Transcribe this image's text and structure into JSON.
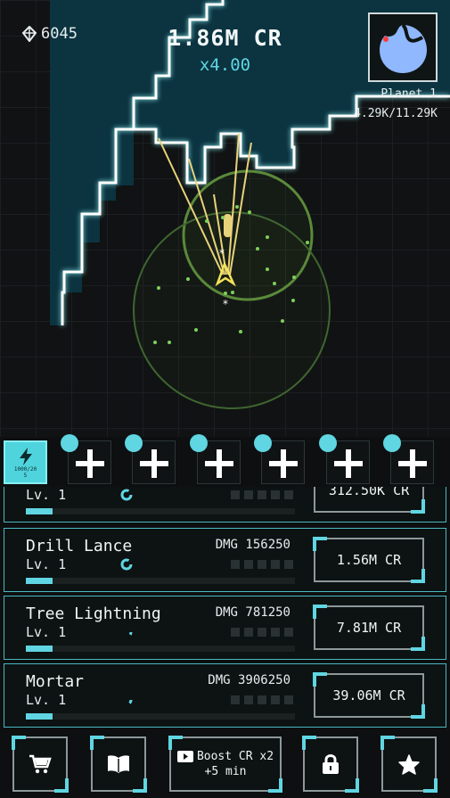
{
  "hud": {
    "gems": "6045",
    "credits": "1.86M CR",
    "multiplier": "x4.00",
    "planet_name": "Planet 1",
    "planet_progress": "4.29K/11.29K"
  },
  "slots": {
    "active_label": "1000/20\n5",
    "empty_count": 6
  },
  "upgrades": [
    {
      "name": "",
      "level": "Lv. 1",
      "dmg": "",
      "cost": "312.50K CR",
      "progress": 0.1
    },
    {
      "name": "Drill Lance",
      "level": "Lv. 1",
      "dmg": "DMG 156250",
      "cost": "1.56M CR",
      "progress": 0.1
    },
    {
      "name": "Tree Lightning",
      "level": "Lv. 1",
      "dmg": "DMG 781250",
      "cost": "7.81M CR",
      "progress": 0.1
    },
    {
      "name": "Mortar",
      "level": "Lv. 1",
      "dmg": "DMG 3906250",
      "cost": "39.06M CR",
      "progress": 0.1
    }
  ],
  "nav": {
    "boost_line1": "Boost CR x2",
    "boost_line2": "+5 min"
  },
  "colors": {
    "accent": "#5fd6e2",
    "terrain": "#0b3340",
    "laser": "#e8d27a",
    "ring": "#5a8a3a"
  },
  "icons": [
    "gem-icon",
    "lightning-icon",
    "plus-icon",
    "cart-icon",
    "book-icon",
    "play-icon",
    "lock-icon",
    "star-icon"
  ]
}
